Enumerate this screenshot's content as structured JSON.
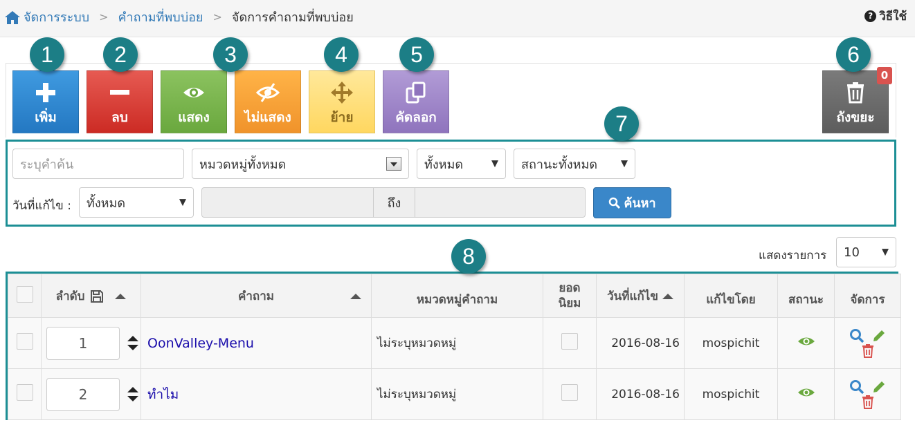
{
  "breadcrumb": {
    "items": [
      "จัดการระบบ",
      "คำถามที่พบบ่อย"
    ],
    "current": "จัดการคำถามที่พบบ่อย",
    "separator": ">"
  },
  "help": {
    "label": "วิธีใช้"
  },
  "toolbar": {
    "add": "เพิ่ม",
    "delete": "ลบ",
    "show": "แสดง",
    "hide": "ไม่แสดง",
    "move": "ย้าย",
    "copy": "คัดลอก",
    "trash": "ถังขยะ",
    "trash_count": "0"
  },
  "callouts": [
    "1",
    "2",
    "3",
    "4",
    "5",
    "6",
    "7",
    "8"
  ],
  "filter": {
    "keyword_placeholder": "ระบุคำค้น",
    "category_selected": "หมวดหมู่ทั้งหมด",
    "scope_selected": "ทั้งหมด",
    "status_selected": "สถานะทั้งหมด",
    "date_label": "วันที่แก้ไข :",
    "date_selected": "ทั้งหมด",
    "date_to": "ถึง",
    "search_button": "ค้นหา"
  },
  "pagesize": {
    "label": "แสดงรายการ",
    "selected": "10"
  },
  "table": {
    "headers": {
      "order": "ลำดับ",
      "question": "คำถาม",
      "category": "หมวดหมู่คำถาม",
      "popular": "ยอด นิยม",
      "modified": "วันที่แก้ไข",
      "modified_by": "แก้ไขโดย",
      "status": "สถานะ",
      "manage": "จัดการ"
    },
    "rows": [
      {
        "order": "1",
        "question": "OonValley-Menu",
        "category": "ไม่ระบุหมวดหมู่",
        "modified": "2016-08-16",
        "modified_by": "mospichit"
      },
      {
        "order": "2",
        "question": "ทำไม",
        "category": "ไม่ระบุหมวดหมู่",
        "modified": "2016-08-16",
        "modified_by": "mospichit"
      }
    ]
  },
  "colors": {
    "accent": "#1c8f95",
    "callout": "#1c7e86",
    "link": "#337ab7",
    "eye": "#6aa83e",
    "search": "#3a87c9",
    "edit": "#6aa83e",
    "delete": "#d9534f"
  }
}
